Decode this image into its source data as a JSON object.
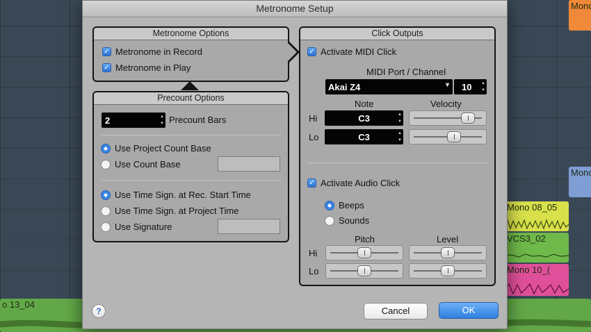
{
  "window": {
    "title": "Metronome Setup"
  },
  "background_clips": {
    "top_right": "Mono",
    "mid_right": "Mono",
    "yellow": "Mono 08_05",
    "green": "VCS3_02",
    "pink": "Mono 10_(",
    "bottom": "o 13_04"
  },
  "metronome_options": {
    "title": "Metronome Options",
    "record_label": "Metronome in Record",
    "record_checked": true,
    "play_label": "Metronome in Play",
    "play_checked": true
  },
  "precount_options": {
    "title": "Precount Options",
    "bars_value": "2",
    "bars_label": "Precount Bars",
    "use_project_count_base": "Use Project Count Base",
    "use_count_base": "Use Count Base",
    "count_base_selected": "Use Project Count Base",
    "time_sign_rec_start": "Use Time Sign. at Rec. Start Time",
    "time_sign_project": "Use Time Sign. at Project Time",
    "use_signature": "Use Signature",
    "time_sign_selected": "Use Time Sign. at Rec. Start Time"
  },
  "click_outputs": {
    "title": "Click Outputs",
    "midi_click_label": "Activate MIDI Click",
    "midi_click_checked": true,
    "port_channel_label": "MIDI Port / Channel",
    "port_value": "Akai Z4",
    "channel_value": "10",
    "note_header": "Note",
    "velocity_header": "Velocity",
    "hi_label": "Hi",
    "lo_label": "Lo",
    "hi_note": "C3",
    "lo_note": "C3",
    "hi_velocity_fraction": 0.84,
    "lo_velocity_fraction": 0.6,
    "audio_click_label": "Activate Audio Click",
    "audio_click_checked": true,
    "beeps_label": "Beeps",
    "sounds_label": "Sounds",
    "audio_source_selected": "Beeps",
    "pitch_header": "Pitch",
    "level_header": "Level",
    "hi_pitch_fraction": 0.5,
    "lo_pitch_fraction": 0.5,
    "hi_level_fraction": 0.5,
    "lo_level_fraction": 0.5
  },
  "footer": {
    "help_label": "?",
    "cancel_label": "Cancel",
    "ok_label": "OK"
  },
  "colors": {
    "accent": "#3a86e6",
    "ok_button": "#3f8ee9",
    "clip_yellow": "#d8e04a",
    "clip_green": "#6fb84a",
    "clip_pink": "#e0509a",
    "clip_orange": "#f08a3a",
    "clip_blue": "#7f9ed6"
  }
}
